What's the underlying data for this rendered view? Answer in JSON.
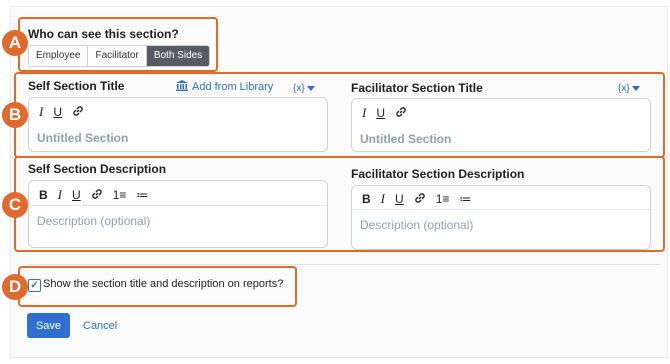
{
  "visibility": {
    "label": "Who can see this section?",
    "options": [
      "Employee",
      "Facilitator",
      "Both Sides"
    ],
    "selected": "Both Sides"
  },
  "titles": {
    "self_label": "Self Section Title",
    "add_from_library": "Add from Library",
    "var_button": "{x}",
    "self_placeholder": "Untitled Section",
    "facilitator_label": "Facilitator Section Title",
    "facilitator_placeholder": "Untitled Section"
  },
  "descriptions": {
    "self_label": "Self Section Description",
    "self_placeholder": "Description (optional)",
    "facilitator_label": "Facilitator Section Description",
    "facilitator_placeholder": "Description (optional)"
  },
  "toolbar": {
    "bold": "B",
    "italic": "I",
    "underline": "U",
    "ordered_list": "1≡",
    "bullet_list": "≔"
  },
  "report_option": {
    "label": "Show the section title and description on reports?",
    "checked": true
  },
  "actions": {
    "save": "Save",
    "cancel": "Cancel"
  },
  "callouts": [
    "A",
    "B",
    "C",
    "D"
  ],
  "colors": {
    "callout": "#e06a2b",
    "primary": "#2f6fd0",
    "placeholder": "#8ea0b8",
    "segment_active": "#555b63"
  }
}
